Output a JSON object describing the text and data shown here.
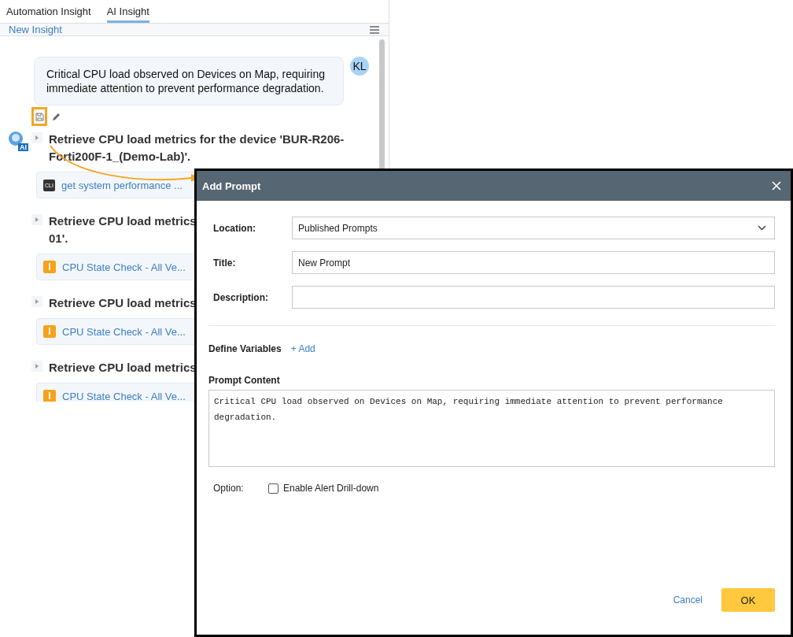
{
  "tabs": [
    {
      "label": "Automation Insight",
      "selected": false
    },
    {
      "label": "AI Insight",
      "selected": true
    }
  ],
  "toolbar": {
    "title": "New Insight"
  },
  "user_message": {
    "text": "Critical CPU load observed on Devices on Map, requiring immediate attention to prevent performance degradation.",
    "avatar": "KL"
  },
  "steps": [
    {
      "avatar": "AI",
      "lines": [
        "Retrieve CPU load metrics for the device 'BUR-R206-",
        "Forti200F-1_(Demo-Lab)'."
      ],
      "tool": {
        "kind": "cli",
        "badge": "CLI",
        "label": "get system performance ..."
      }
    },
    {
      "lines": [
        "Retrieve CPU load metrics",
        "01'."
      ],
      "tool": {
        "kind": "insight",
        "badge": "I",
        "label": "CPU State Check - All Ve..."
      }
    },
    {
      "lines": [
        "Retrieve CPU load metrics"
      ],
      "tool": {
        "kind": "insight",
        "badge": "I",
        "label": "CPU State Check - All Ve..."
      }
    },
    {
      "lines": [
        "Retrieve CPU load metrics"
      ],
      "tool": {
        "kind": "insight",
        "badge": "I",
        "label": "CPU State Check - All Ve..."
      }
    }
  ],
  "dialog": {
    "title": "Add Prompt",
    "fields": [
      {
        "kind": "select",
        "label": "Location:",
        "value": "Published Prompts"
      },
      {
        "kind": "text",
        "label": "Title:",
        "value": "New Prompt"
      },
      {
        "kind": "text",
        "label": "Description:"
      }
    ],
    "variables": {
      "label": "Define Variables",
      "add": "+ Add"
    },
    "content": {
      "label": "Prompt Content",
      "value": "Critical CPU load observed on Devices on Map, requiring immediate attention to prevent performance degradation."
    },
    "option": {
      "label": "Option:",
      "checkbox": {
        "label": "Enable Alert Drill-down",
        "checked": false
      }
    },
    "buttons": {
      "cancel": "Cancel",
      "ok": "OK"
    }
  }
}
